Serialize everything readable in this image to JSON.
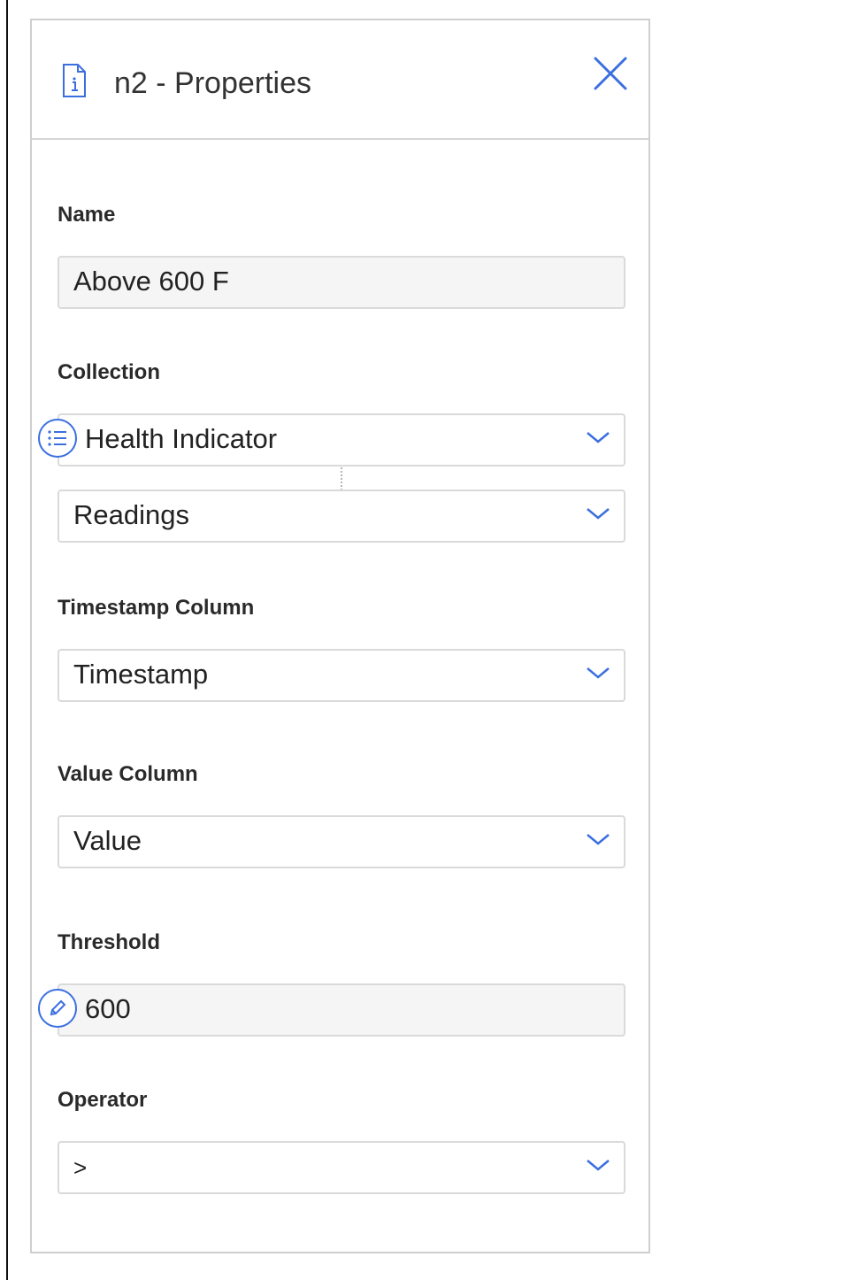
{
  "panel": {
    "title": "n2 - Properties",
    "icons": {
      "document": "document-info-icon",
      "close": "close-icon",
      "chevron": "chevron-down-icon",
      "list": "list-icon",
      "edit": "pencil-icon"
    },
    "accent_color": "#3b6fe0"
  },
  "fields": {
    "name": {
      "label": "Name",
      "value": "Above 600 F"
    },
    "collection": {
      "label": "Collection",
      "primary_value": "Health Indicator",
      "secondary_value": "Readings"
    },
    "timestamp_column": {
      "label": "Timestamp Column",
      "value": "Timestamp"
    },
    "value_column": {
      "label": "Value Column",
      "value": "Value"
    },
    "threshold": {
      "label": "Threshold",
      "value": "600"
    },
    "operator": {
      "label": "Operator",
      "value": ">"
    }
  }
}
